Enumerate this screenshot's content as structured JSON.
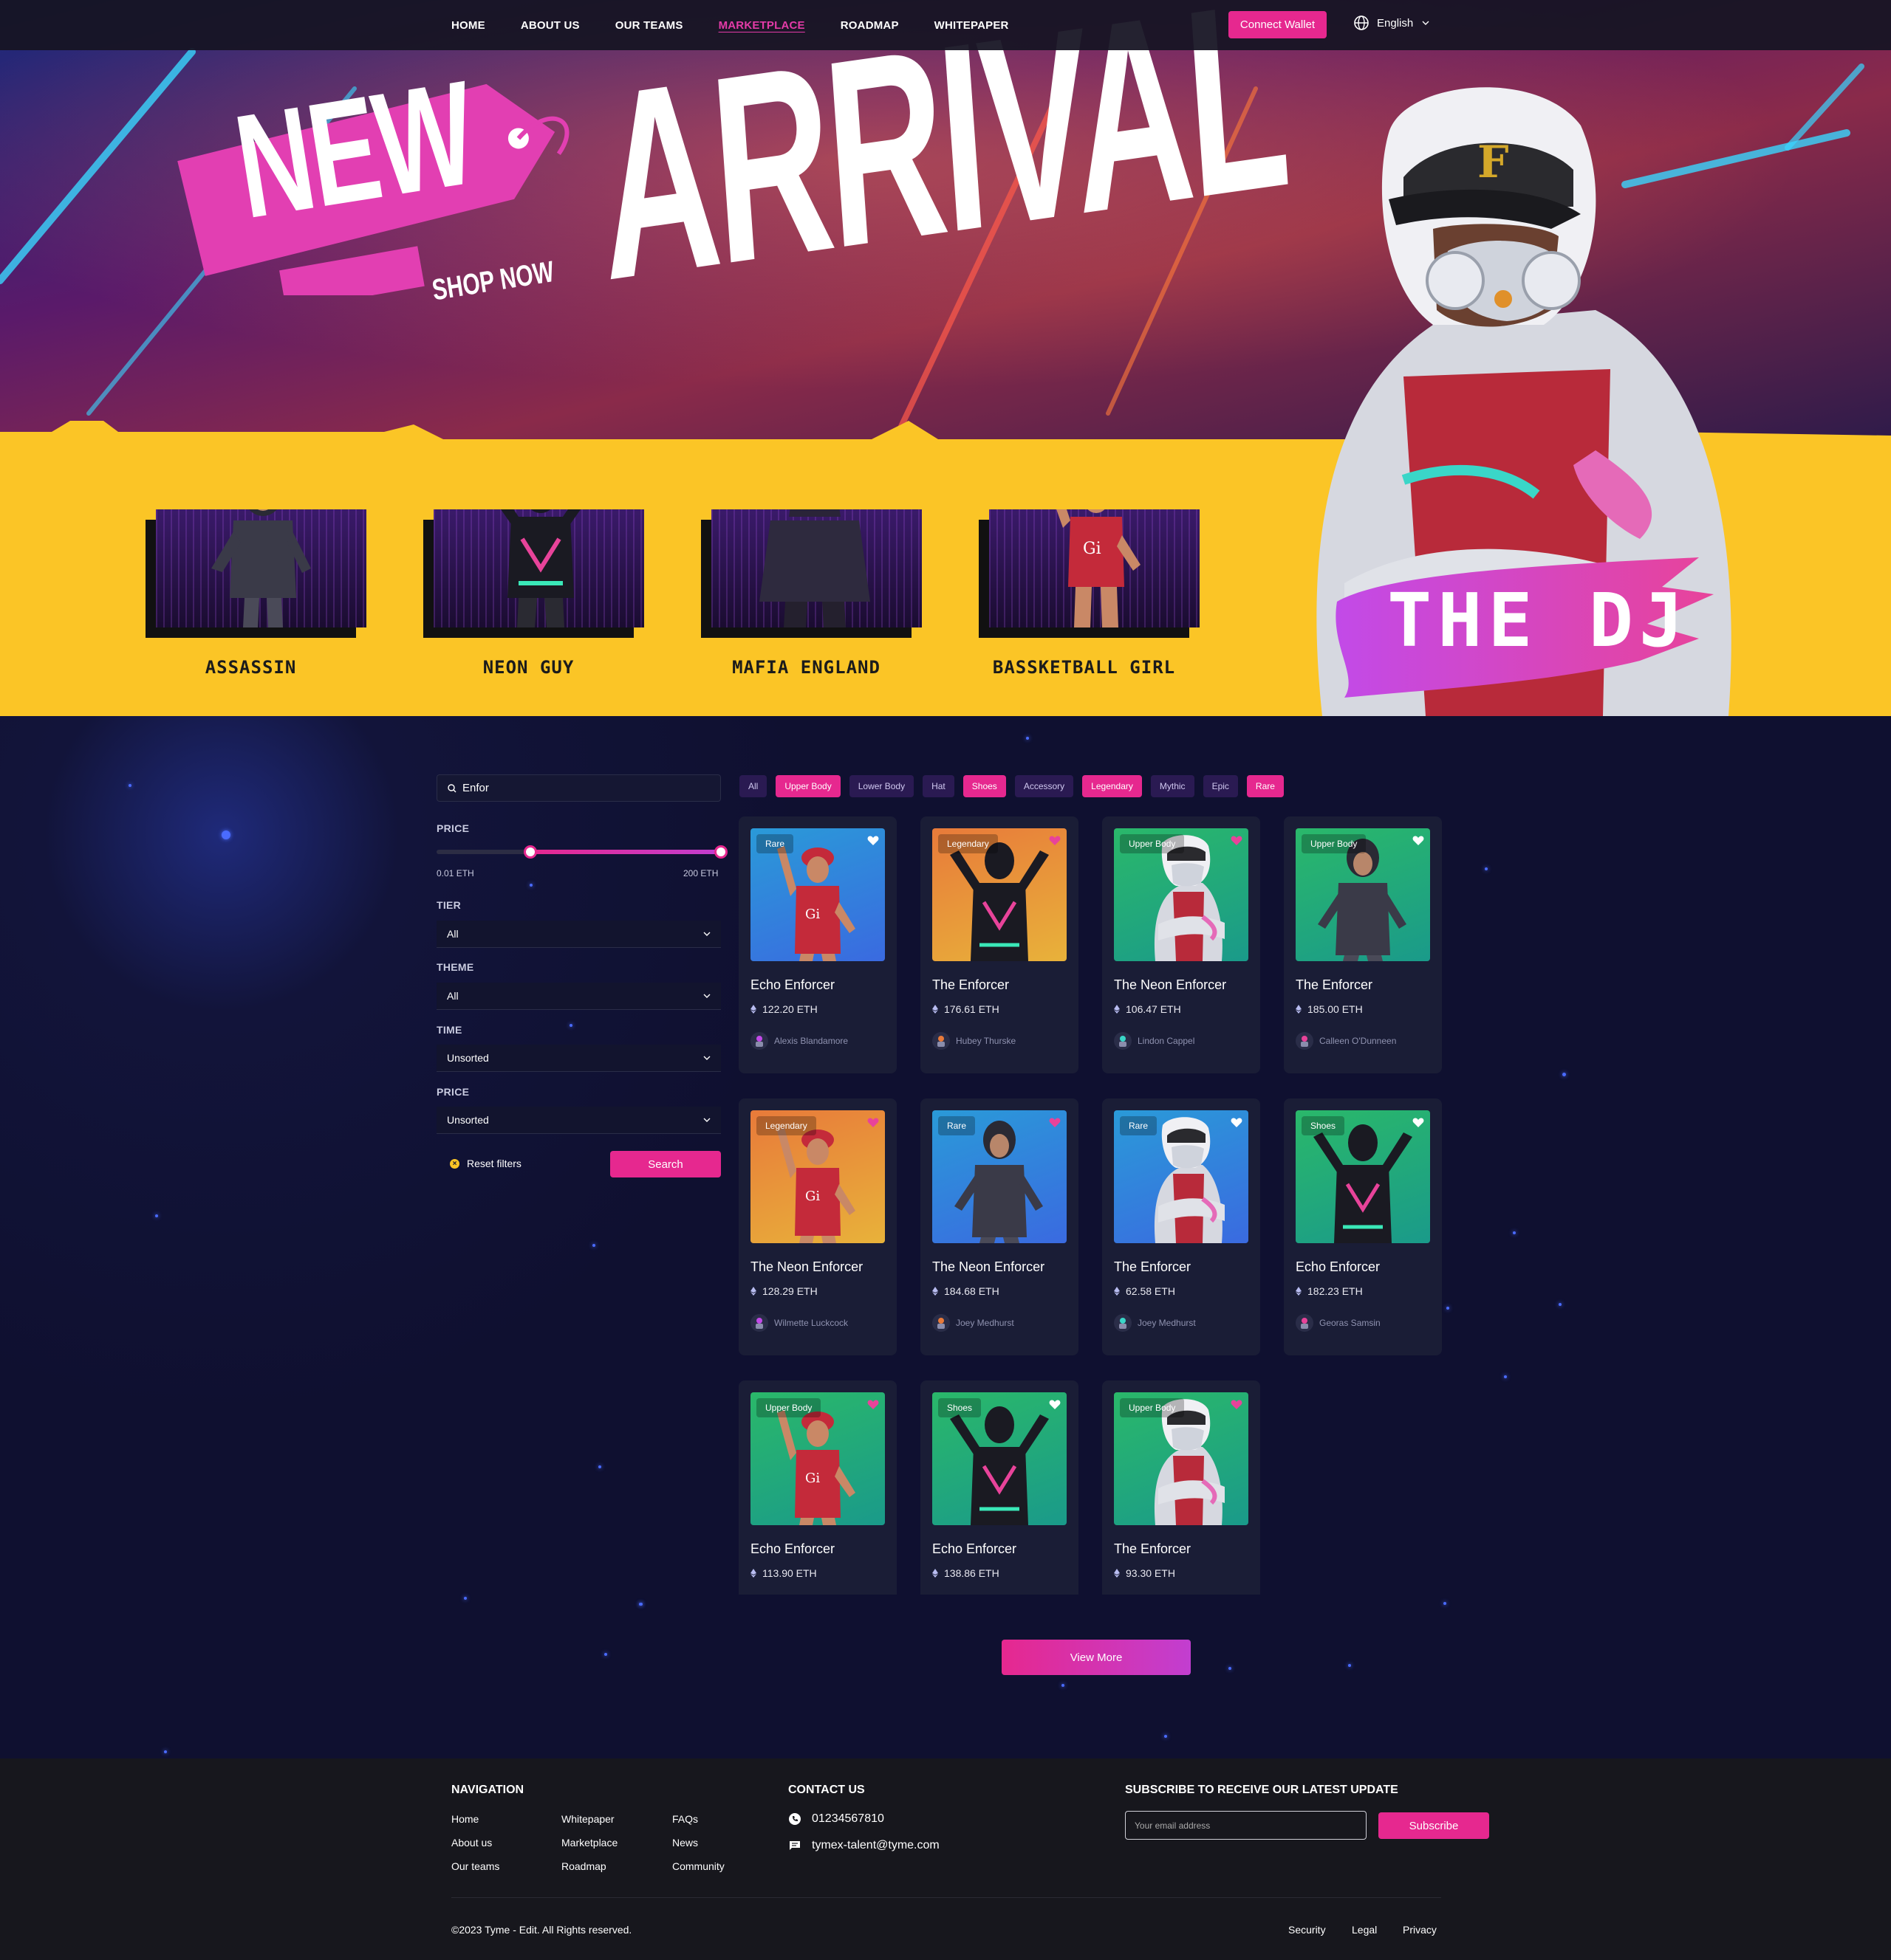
{
  "nav": {
    "links": [
      "HOME",
      "ABOUT US",
      "OUR TEAMS",
      "MARKETPLACE",
      "ROADMAP",
      "WHITEPAPER"
    ],
    "active": "MARKETPLACE",
    "connect_label": "Connect Wallet",
    "language": "English"
  },
  "hero": {
    "tag_text": "NEW",
    "shop_text": "SHOP NOW",
    "headline": "ARRIVAL",
    "featured": "THE DJ",
    "characters": [
      "ASSASSIN",
      "NEON GUY",
      "MAFIA ENGLAND",
      "BASSKETBALL GIRL"
    ],
    "colors": {
      "accent": "#e6288f",
      "yellow": "#fbc526",
      "purple": "#c23ed0"
    }
  },
  "filters": {
    "search_value": "Enfor",
    "price_label": "PRICE",
    "price_min": "0.01 ETH",
    "price_max": "200 ETH",
    "price_range_fraction": [
      0.33,
      1.0
    ],
    "tier_label": "TIER",
    "tier_value": "All",
    "theme_label": "THEME",
    "theme_value": "All",
    "time_label": "TIME",
    "time_value": "Unsorted",
    "price_sort_label": "PRICE",
    "price_sort_value": "Unsorted",
    "reset_label": "Reset filters",
    "search_label": "Search"
  },
  "chips": [
    {
      "label": "All",
      "on": false
    },
    {
      "label": "Upper Body",
      "on": true
    },
    {
      "label": "Lower Body",
      "on": false
    },
    {
      "label": "Hat",
      "on": false
    },
    {
      "label": "Shoes",
      "on": true
    },
    {
      "label": "Accessory",
      "on": false
    },
    {
      "label": "Legendary",
      "on": true
    },
    {
      "label": "Mythic",
      "on": false
    },
    {
      "label": "Epic",
      "on": false
    },
    {
      "label": "Rare",
      "on": true
    }
  ],
  "cards": [
    {
      "badge": "Rare",
      "title": "Echo Enforcer",
      "price": "122.20 ETH",
      "owner": "Alexis Blandamore",
      "bg": "blue",
      "char": "girl",
      "heart": "white"
    },
    {
      "badge": "Legendary",
      "title": "The Enforcer",
      "price": "176.61 ETH",
      "owner": "Hubey Thurske",
      "bg": "orange",
      "char": "neon",
      "heart": "pink"
    },
    {
      "badge": "Upper Body",
      "title": "The Neon Enforcer",
      "price": "106.47 ETH",
      "owner": "Lindon Cappel",
      "bg": "green",
      "char": "dj",
      "heart": "pink"
    },
    {
      "badge": "Upper Body",
      "title": "The Enforcer",
      "price": "185.00 ETH",
      "owner": "Calleen O'Dunneen",
      "bg": "green",
      "char": "assassin",
      "heart": "white"
    },
    {
      "badge": "Legendary",
      "title": "The Neon Enforcer",
      "price": "128.29 ETH",
      "owner": "Wilmette Luckcock",
      "bg": "orange",
      "char": "girl",
      "heart": "pink"
    },
    {
      "badge": "Rare",
      "title": "The Neon Enforcer",
      "price": "184.68 ETH",
      "owner": "Joey Medhurst",
      "bg": "blue",
      "char": "assassin",
      "heart": "pink"
    },
    {
      "badge": "Rare",
      "title": "The Enforcer",
      "price": "62.58 ETH",
      "owner": "Joey Medhurst",
      "bg": "blue",
      "char": "dj",
      "heart": "white"
    },
    {
      "badge": "Shoes",
      "title": "Echo Enforcer",
      "price": "182.23 ETH",
      "owner": "Georas Samsin",
      "bg": "green",
      "char": "neon",
      "heart": "white"
    },
    {
      "badge": "Upper Body",
      "title": "Echo Enforcer",
      "price": "113.90 ETH",
      "owner": "",
      "bg": "green",
      "char": "girl",
      "heart": "pink"
    },
    {
      "badge": "Shoes",
      "title": "Echo Enforcer",
      "price": "138.86 ETH",
      "owner": "",
      "bg": "green",
      "char": "neon",
      "heart": "white"
    },
    {
      "badge": "Upper Body",
      "title": "The Enforcer",
      "price": "93.30 ETH",
      "owner": "",
      "bg": "green",
      "char": "dj",
      "heart": "pink"
    }
  ],
  "view_more": "View More",
  "footer": {
    "nav_heading": "NAVIGATION",
    "nav_links": [
      "Home",
      "About us",
      "Our teams",
      "Whitepaper",
      "Marketplace",
      "Roadmap",
      "FAQs",
      "News",
      "Community"
    ],
    "contact_heading": "CONTACT US",
    "phone": "01234567810",
    "email": "tymex-talent@tyme.com",
    "subscribe_heading": "SUBSCRIBE TO RECEIVE OUR LATEST UPDATE",
    "email_placeholder": "Your email address",
    "subscribe_label": "Subscribe",
    "copyright": "©2023 Tyme - Edit. All Rights reserved.",
    "legal_links": [
      "Security",
      "Legal",
      "Privacy"
    ]
  }
}
